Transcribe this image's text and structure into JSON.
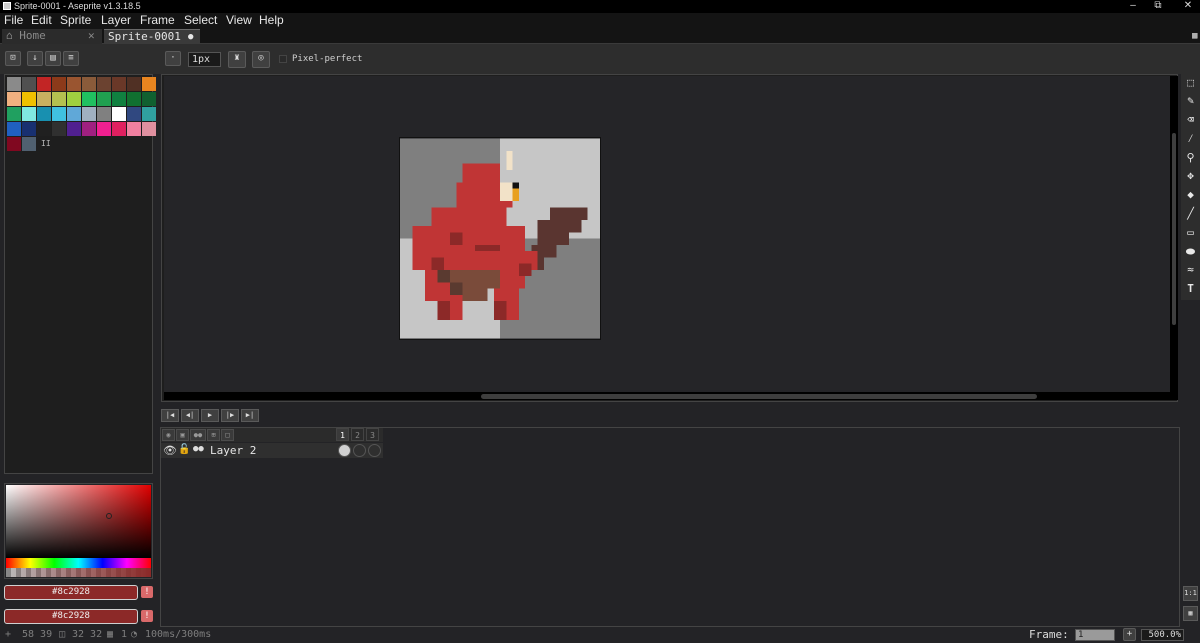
{
  "window": {
    "title": "Sprite-0001 - Aseprite v1.3.18.5"
  },
  "menu": [
    "File",
    "Edit",
    "Sprite",
    "Layer",
    "Frame",
    "Select",
    "View",
    "Help"
  ],
  "tabs": {
    "home": "Home",
    "sprite": "Sprite-0001"
  },
  "context_bar": {
    "brush_size": "1px",
    "pixel_perfect_label": "Pixel-perfect"
  },
  "palette": {
    "colors": [
      "#8a8a8a",
      "#505050",
      "#c22525",
      "#8c3a1a",
      "#9a5530",
      "#8a5b3a",
      "#6b4230",
      "#6a3828",
      "#503024",
      "#e88520",
      "#f0b080",
      "#f0c000",
      "#c8b060",
      "#b4c050",
      "#a0d040",
      "#20c060",
      "#20a050",
      "#108040",
      "#107030",
      "#106030",
      "#20a060",
      "#80e8e0",
      "#1890b0",
      "#40c0e0",
      "#60a8d8",
      "#a0b0c0",
      "#808080",
      "#ffffff",
      "#304880",
      "#30a0a0",
      "#2060c0",
      "#183070",
      "#202020",
      "#303030",
      "#502090",
      "#a02080",
      "#f02090",
      "#e02060",
      "#f080a0",
      "#e090a0",
      "#800820",
      "#506070"
    ],
    "page_indicator": "II"
  },
  "colors": {
    "foreground": "#8c2928",
    "background": "#8c2928",
    "warning_symbol": "!"
  },
  "timeline": {
    "frames": [
      "1",
      "2",
      "3"
    ],
    "layers": [
      {
        "name": "Layer 2"
      }
    ]
  },
  "status": {
    "position": "58 39",
    "size": "32 32",
    "frame_info": "1",
    "durations": "100ms/300ms",
    "frame_label": "Frame:",
    "frame_value": "1",
    "zoom": "500.0%"
  },
  "sprite_pixels": "red horned creature holding club on gray checkerboard"
}
